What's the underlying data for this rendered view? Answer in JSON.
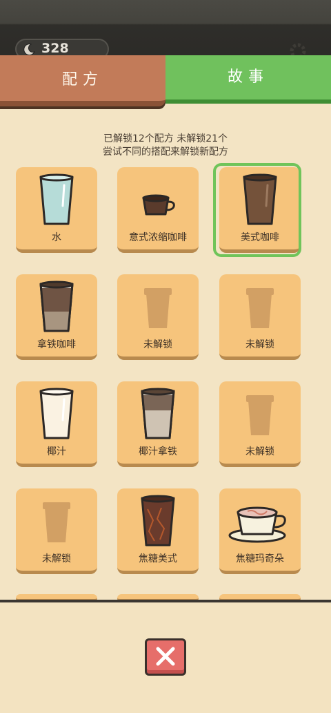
{
  "header": {
    "coins": "328"
  },
  "tabs": {
    "recipe": "配方",
    "story": "故事"
  },
  "summary": {
    "line1": "已解锁12个配方 未解锁21个",
    "line2": "尝试不同的搭配来解锁新配方"
  },
  "recipes": [
    {
      "label": "水",
      "icon": "water-glass"
    },
    {
      "label": "意式浓缩咖啡",
      "icon": "espresso-cup"
    },
    {
      "label": "美式咖啡",
      "icon": "americano-glass",
      "selected": true
    },
    {
      "label": "拿铁咖啡",
      "icon": "latte-glass"
    },
    {
      "label": "未解锁",
      "icon": "locked-cup"
    },
    {
      "label": "未解锁",
      "icon": "locked-cup"
    },
    {
      "label": "椰汁",
      "icon": "coconut-glass"
    },
    {
      "label": "椰汁拿铁",
      "icon": "coconut-latte-glass"
    },
    {
      "label": "未解锁",
      "icon": "locked-cup"
    },
    {
      "label": "未解锁",
      "icon": "locked-cup"
    },
    {
      "label": "焦糖美式",
      "icon": "caramel-americano-glass"
    },
    {
      "label": "焦糖玛奇朵",
      "icon": "caramel-macchiato-cup"
    }
  ],
  "colors": {
    "accent_green": "#70c15d",
    "tab_brown": "#c27b59",
    "card": "#f6c47c",
    "close_red": "#e66e6a"
  }
}
